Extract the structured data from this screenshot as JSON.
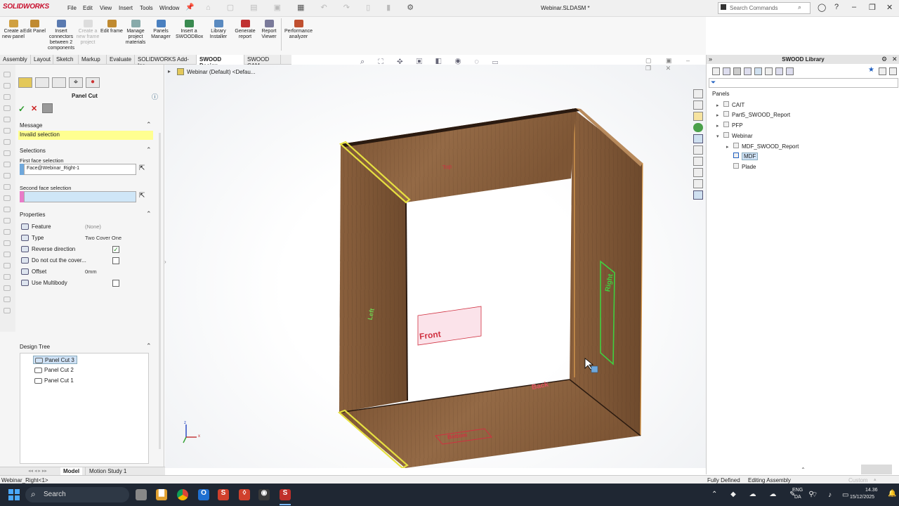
{
  "app": {
    "logo": "SOLIDWORKS",
    "doc_title": "Webinar.SLDASM *"
  },
  "menu": [
    "File",
    "Edit",
    "View",
    "Insert",
    "Tools",
    "Window"
  ],
  "search": {
    "placeholder": "Search Commands"
  },
  "commands": [
    {
      "label": "Create a new panel",
      "icon": "new-panel-icon",
      "disabled": false
    },
    {
      "label": "Edit Panel",
      "icon": "edit-panel-icon",
      "disabled": false
    },
    {
      "label": "Insert connectors between 2 components",
      "icon": "connector-icon",
      "disabled": false
    },
    {
      "label": "Create a new frame project",
      "icon": "frame-icon",
      "disabled": true
    },
    {
      "label": "Edit frame",
      "icon": "edit-frame-icon",
      "disabled": false
    },
    {
      "label": "Manage project materials",
      "icon": "materials-icon",
      "disabled": false
    },
    {
      "label": "Panels Manager",
      "icon": "panels-manager-icon",
      "disabled": false
    },
    {
      "label": "Insert a SWOODBox",
      "icon": "swoodbox-icon",
      "disabled": false
    },
    {
      "label": "Library Installer",
      "icon": "cloud-icon",
      "disabled": false
    },
    {
      "label": "Generate report",
      "icon": "report-icon",
      "disabled": false
    },
    {
      "label": "Report Viewer",
      "icon": "report-viewer-icon",
      "disabled": false
    },
    {
      "label": "Performance analyzer",
      "icon": "performance-icon",
      "disabled": false
    }
  ],
  "tabs": [
    "Assembly",
    "Layout",
    "Sketch",
    "Markup",
    "Evaluate",
    "SOLIDWORKS Add-Ins",
    "SWOOD Design",
    "SWOOD CAM"
  ],
  "active_tab": "SWOOD Design",
  "property_manager": {
    "title": "Panel Cut",
    "message_header": "Message",
    "message_text": "Invalid selection",
    "selections_header": "Selections",
    "first_face_label": "First face selection",
    "first_face_value": "Face@Webinar_Right-1",
    "second_face_label": "Second face selection",
    "second_face_value": "",
    "properties_header": "Properties",
    "properties": [
      {
        "label": "Feature",
        "value": "(None)",
        "icon": "feature-icon"
      },
      {
        "label": "Type",
        "value": "Two Cover One",
        "icon": "type-icon"
      },
      {
        "label": "Reverse direction",
        "value": "",
        "icon": "toggle-icon",
        "checkbox": true,
        "checked": true
      },
      {
        "label": "Do not cut the cover...",
        "value": "",
        "icon": "toggle-icon",
        "checkbox": true,
        "checked": false
      },
      {
        "label": "Offset",
        "value": "0mm",
        "icon": "offset-icon"
      },
      {
        "label": "Use Multibody",
        "value": "",
        "icon": "toggle-icon",
        "checkbox": true,
        "checked": false
      }
    ],
    "design_tree_header": "Design Tree",
    "design_tree": [
      "Panel Cut 3",
      "Panel Cut 2",
      "Panel Cut 1"
    ],
    "design_tree_selected": "Panel Cut 3"
  },
  "viewport": {
    "tree_root": "Webinar (Default) <Defau...",
    "labels": {
      "top": "Top",
      "left": "Left",
      "right": "Right",
      "front": "Front",
      "back": "Back",
      "bottom": "Bottom"
    },
    "triad": {
      "z": "z",
      "x": "x"
    }
  },
  "library": {
    "title": "SWOOD Library",
    "tree": [
      {
        "label": "Panels",
        "level": 0,
        "expander": ""
      },
      {
        "label": "CAIT",
        "level": 1,
        "expander": "▸"
      },
      {
        "label": "Part5_SWOOD_Report",
        "level": 1,
        "expander": "▸"
      },
      {
        "label": "PFP",
        "level": 1,
        "expander": "▸"
      },
      {
        "label": "Webinar",
        "level": 1,
        "expander": "▾"
      },
      {
        "label": "MDF_SWOOD_Report",
        "level": 2,
        "expander": "▸"
      },
      {
        "label": "MDF",
        "level": 2,
        "expander": "",
        "selected": true
      },
      {
        "label": "Plade",
        "level": 2,
        "expander": ""
      }
    ]
  },
  "bottom_tabs": [
    "Model",
    "Motion Study 1"
  ],
  "status": {
    "left": "Webinar_Right<1>",
    "fully_defined": "Fully Defined",
    "editing": "Editing Assembly",
    "custom": "Custom"
  },
  "taskbar": {
    "search": "Search",
    "lang_top": "ENG",
    "lang_bottom": "DA",
    "time": "14.36",
    "date": "15/12/2025",
    "app_colors": [
      "#e0a030",
      "#1f6fd0",
      "#d0402c",
      "#d0402c",
      "#3a3a3a",
      "#c0302a"
    ]
  },
  "colors": {
    "wood": "#8a5e3b",
    "selection_yellow": "#e6e040",
    "selection_green": "#40d040",
    "label_red": "#d03040"
  }
}
